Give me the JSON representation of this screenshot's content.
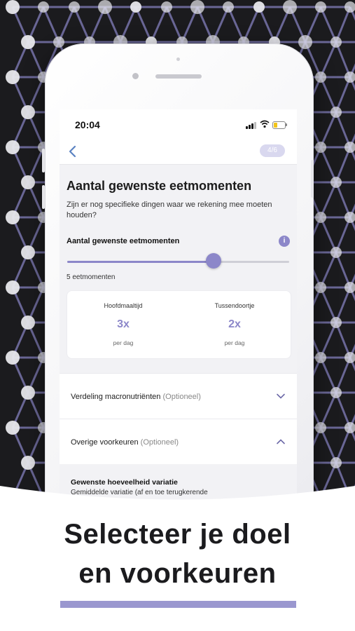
{
  "colors": {
    "accent": "#8c87c9",
    "accent_light": "#9a97cf",
    "background_dark": "#1b1b1e",
    "network_line": "#8a86c8",
    "network_node": "#e8e8ec"
  },
  "status_bar": {
    "time": "20:04",
    "icons": [
      "signal-icon",
      "wifi-icon",
      "battery-icon"
    ]
  },
  "nav": {
    "back_icon": "chevron-left-icon",
    "step": "4/6"
  },
  "page": {
    "title": "Aantal gewenste eetmomenten",
    "description": "Zijn er nog specifieke dingen waar we rekening mee moeten houden?",
    "slider": {
      "label": "Aantal gewenste eetmomenten",
      "info_icon": "i",
      "value_text": "5 eetmomenten",
      "level": 0.66
    },
    "summary": [
      {
        "label": "Hoofdmaaltijd",
        "value": "3x",
        "unit": "per dag"
      },
      {
        "label": "Tussendoortje",
        "value": "2x",
        "unit": "per dag"
      }
    ]
  },
  "sections": [
    {
      "label": "Verdeling macronutriënten",
      "optional": "(Optioneel)",
      "icon": "chevron-down-icon"
    },
    {
      "label": "Overige voorkeuren",
      "optional": "(Optioneel)",
      "icon": "chevron-up-icon"
    }
  ],
  "preference": {
    "title": "Gewenste hoeveelheid variatie",
    "description": "Gemiddelde variatie (af en toe terugkerende maaltijden)"
  },
  "caption": {
    "line1": "Selecteer je doel",
    "line2": "en voorkeuren"
  }
}
